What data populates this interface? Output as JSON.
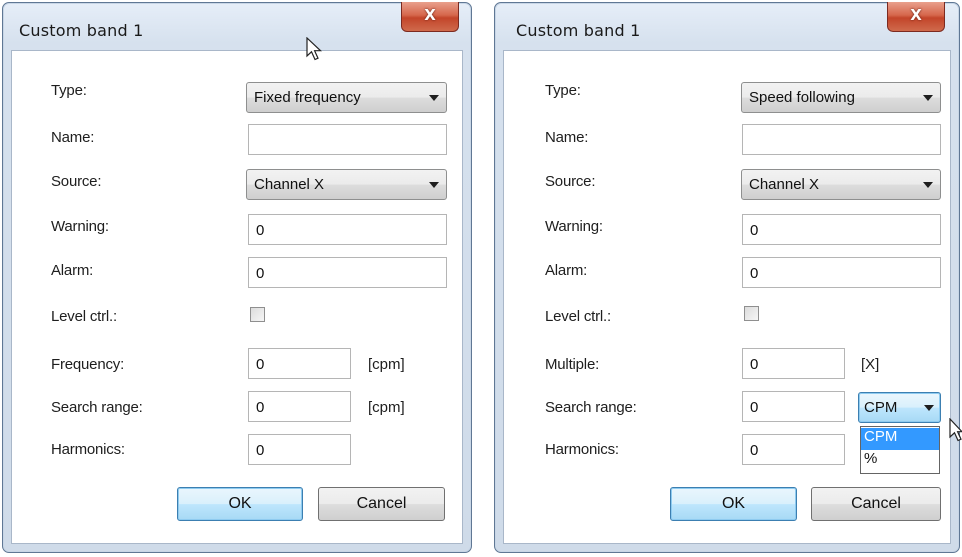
{
  "left_dialog": {
    "title": "Custom band 1",
    "close_label": "X",
    "type": {
      "label": "Type:",
      "value": "Fixed frequency"
    },
    "name": {
      "label": "Name:",
      "value": ""
    },
    "source": {
      "label": "Source:",
      "value": "Channel X"
    },
    "warning": {
      "label": "Warning:",
      "value": "0"
    },
    "alarm": {
      "label": "Alarm:",
      "value": "0"
    },
    "level_ctrl": {
      "label": "Level ctrl.:",
      "checked": false
    },
    "frequency": {
      "label": "Frequency:",
      "value": "0",
      "unit": "[cpm]"
    },
    "search_range": {
      "label": "Search range:",
      "value": "0",
      "unit": "[cpm]"
    },
    "harmonics": {
      "label": "Harmonics:",
      "value": "0"
    },
    "ok_label": "OK",
    "cancel_label": "Cancel"
  },
  "right_dialog": {
    "title": "Custom band 1",
    "close_label": "X",
    "type": {
      "label": "Type:",
      "value": "Speed following"
    },
    "name": {
      "label": "Name:",
      "value": ""
    },
    "source": {
      "label": "Source:",
      "value": "Channel X"
    },
    "warning": {
      "label": "Warning:",
      "value": "0"
    },
    "alarm": {
      "label": "Alarm:",
      "value": "0"
    },
    "level_ctrl": {
      "label": "Level ctrl.:",
      "checked": false
    },
    "multiple": {
      "label": "Multiple:",
      "value": "0",
      "unit": "[X]"
    },
    "search_range": {
      "label": "Search range:",
      "value": "0",
      "unit_selected": "CPM",
      "unit_options": [
        "CPM",
        "%"
      ]
    },
    "harmonics": {
      "label": "Harmonics:",
      "value": "0"
    },
    "ok_label": "OK",
    "cancel_label": "Cancel"
  },
  "colors": {
    "accent": "#3399ff",
    "close": "#c3452a",
    "frame": "#cfdbe9"
  }
}
